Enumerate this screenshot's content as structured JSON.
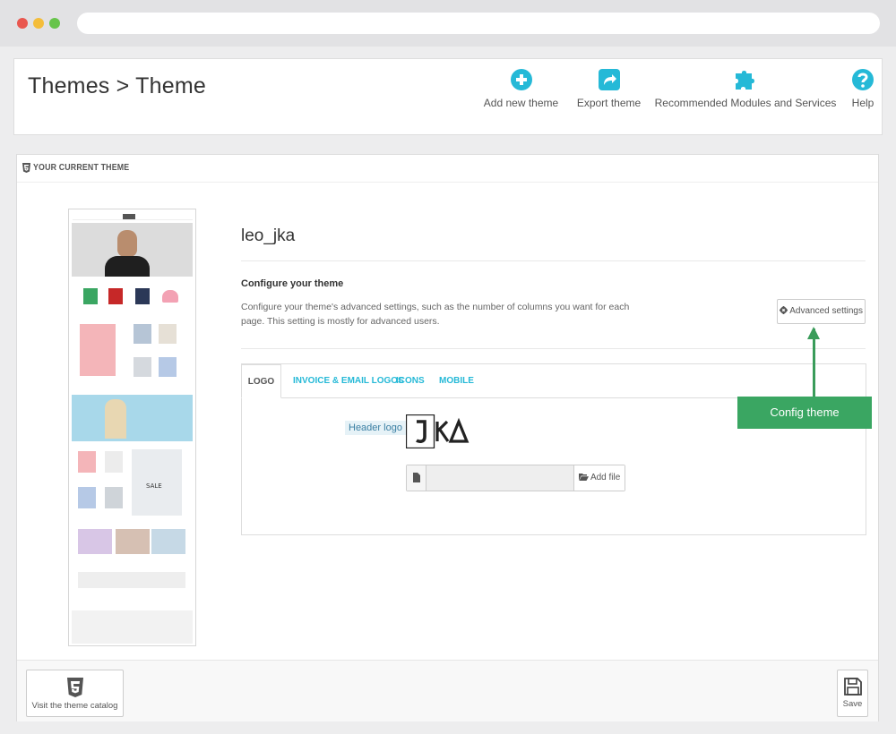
{
  "header": {
    "title": "Themes > Theme",
    "toolbar": [
      {
        "label": "Add new theme",
        "icon": "plus-circle-icon"
      },
      {
        "label": "Export theme",
        "icon": "share-icon"
      },
      {
        "label": "Recommended Modules and Services",
        "icon": "puzzle-icon"
      },
      {
        "label": "Help",
        "icon": "question-circle-icon"
      }
    ]
  },
  "panel": {
    "heading": "YOUR CURRENT THEME",
    "theme_name": "leo_jka",
    "configure": {
      "title": "Configure your theme",
      "description": "Configure your theme's advanced settings, such as the number of columns you want for each page. This setting is mostly for advanced users.",
      "advanced_button": "Advanced settings"
    },
    "tabs": [
      "LOGO",
      "INVOICE & EMAIL LOGOS",
      "ICONS",
      "MOBILE"
    ],
    "logo": {
      "label": "Header logo",
      "add_file": "Add file"
    },
    "callout": "Config theme",
    "footer": {
      "catalog_button": "Visit the theme catalog",
      "save_button": "Save"
    }
  },
  "colors": {
    "accent": "#25b9d7",
    "callout": "#3aa662",
    "window_red": "#e9574f",
    "window_yellow": "#f4bd3a",
    "window_green": "#67c44a"
  }
}
